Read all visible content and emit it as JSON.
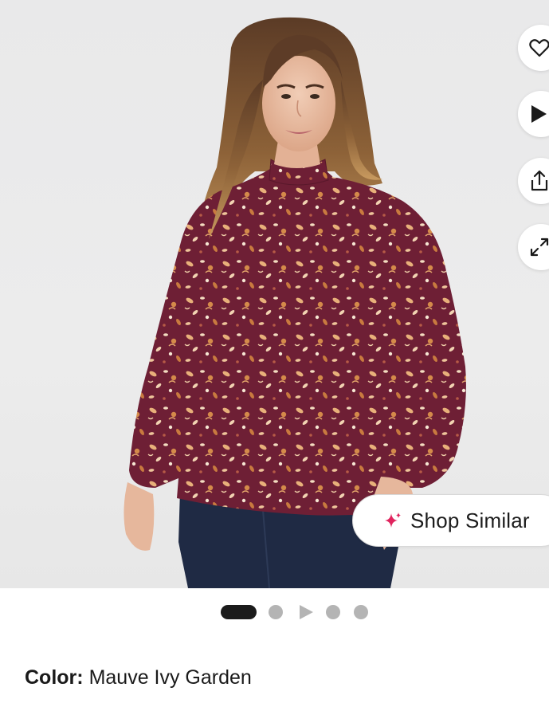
{
  "gallery": {
    "image_alt": "Model wearing mauve floral mock neck long sleeve top",
    "actions": [
      {
        "name": "favorite-button",
        "icon": "heart-icon"
      },
      {
        "name": "video-button",
        "icon": "play-icon"
      },
      {
        "name": "share-button",
        "icon": "share-icon"
      },
      {
        "name": "expand-button",
        "icon": "expand-icon"
      }
    ],
    "shop_similar_label": "Shop Similar",
    "shop_similar_icon": "sparkle-icon",
    "sparkle_color": "#e0245e"
  },
  "carousel": {
    "total": 5,
    "active_index": 0,
    "video_index": 2
  },
  "product": {
    "color_key": "Color:",
    "color_value": "Mauve Ivy Garden"
  }
}
